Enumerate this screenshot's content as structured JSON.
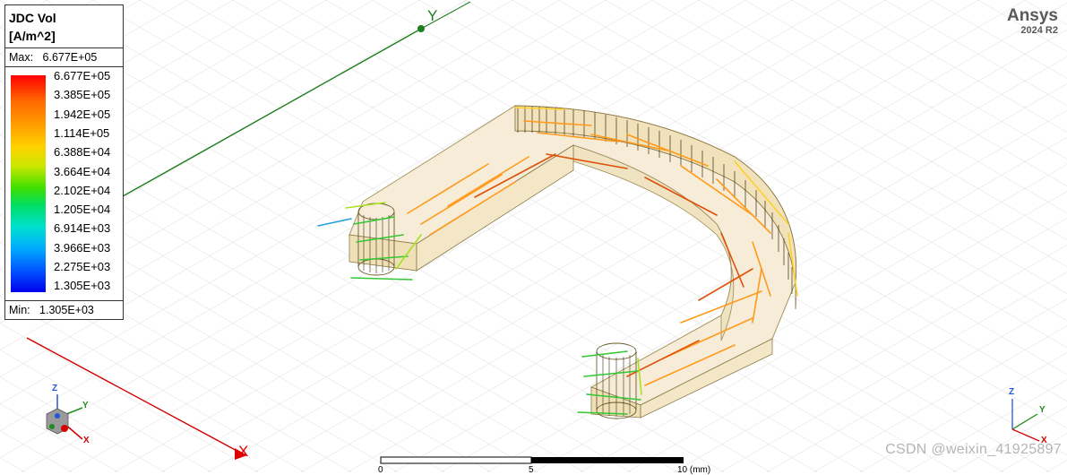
{
  "legend": {
    "title_line1": "JDC Vol",
    "title_line2": "[A/m^2]",
    "max_label": "Max:",
    "max_value": "6.677E+05",
    "min_label": "Min:",
    "min_value": "1.305E+03",
    "scale_values": [
      "6.677E+05",
      "3.385E+05",
      "1.942E+05",
      "1.114E+05",
      "6.388E+04",
      "3.664E+04",
      "2.102E+04",
      "1.205E+04",
      "6.914E+03",
      "3.966E+03",
      "2.275E+03",
      "1.305E+03"
    ]
  },
  "brand": {
    "name": "Ansys",
    "version": "2024 R2"
  },
  "axes": {
    "y_label": "Y",
    "x_label": "X",
    "y_color": "#1e7e1e",
    "x_color": "#e00000"
  },
  "triad_left": {
    "z": "Z",
    "y": "Y",
    "x": "X"
  },
  "triad_right": {
    "z": "Z",
    "y": "Y",
    "x": "X"
  },
  "ruler": {
    "labels": [
      "0",
      "5",
      "10 (mm)"
    ]
  },
  "watermark": "CSDN @weixin_41925897"
}
